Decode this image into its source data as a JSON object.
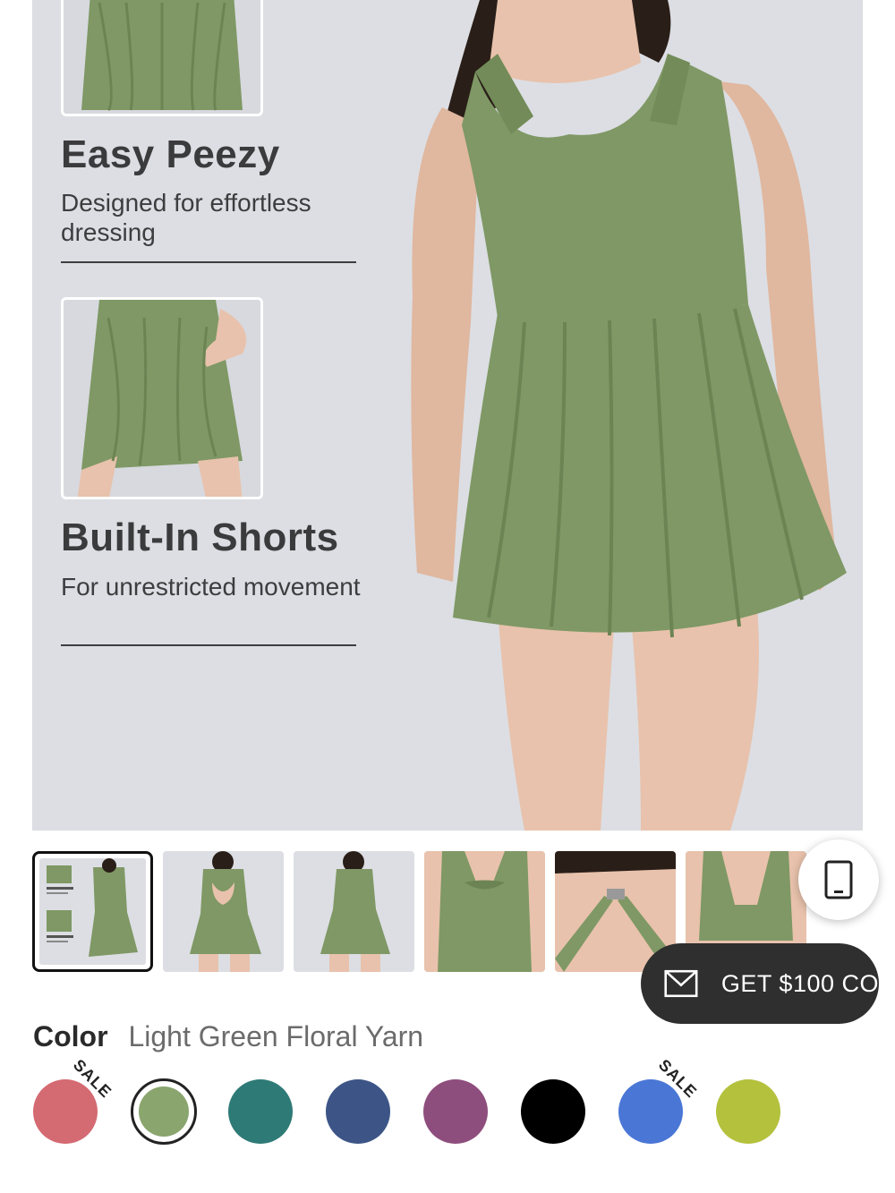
{
  "hero": {
    "features": [
      {
        "title": "Easy Peezy",
        "description": "Designed for effortless dressing"
      },
      {
        "title": "Built-In Shorts",
        "description": "For unrestricted movement"
      }
    ]
  },
  "thumbnails": [
    {
      "name": "thumb-infographic",
      "active": true
    },
    {
      "name": "thumb-back-view"
    },
    {
      "name": "thumb-front-view"
    },
    {
      "name": "thumb-back-twist"
    },
    {
      "name": "thumb-strap-detail"
    },
    {
      "name": "thumb-back-closeup"
    }
  ],
  "promo": {
    "label": "GET $100 CO"
  },
  "color": {
    "key": "Color",
    "value": "Light Green Floral Yarn"
  },
  "swatches": [
    {
      "name": "swatch-pink-heather",
      "color": "#d46a72",
      "sale": true
    },
    {
      "name": "swatch-light-green",
      "color": "#8aa56e",
      "selected": true
    },
    {
      "name": "swatch-teal",
      "color": "#2e7a76"
    },
    {
      "name": "swatch-navy-heather",
      "color": "#3d5586"
    },
    {
      "name": "swatch-plum-heather",
      "color": "#8e4e7d"
    },
    {
      "name": "swatch-black",
      "color": "#000000"
    },
    {
      "name": "swatch-blue-heather",
      "color": "#4a77d6",
      "sale": true
    },
    {
      "name": "swatch-lime",
      "color": "#b4c13d"
    }
  ],
  "sale_label": "SALE",
  "colors": {
    "dress": "#7f9865",
    "skin": "#e8c2ac",
    "hair": "#2a1e18",
    "background": "#dcdee3"
  },
  "icons": {
    "promo": "mail-icon",
    "device": "phone-icon"
  }
}
